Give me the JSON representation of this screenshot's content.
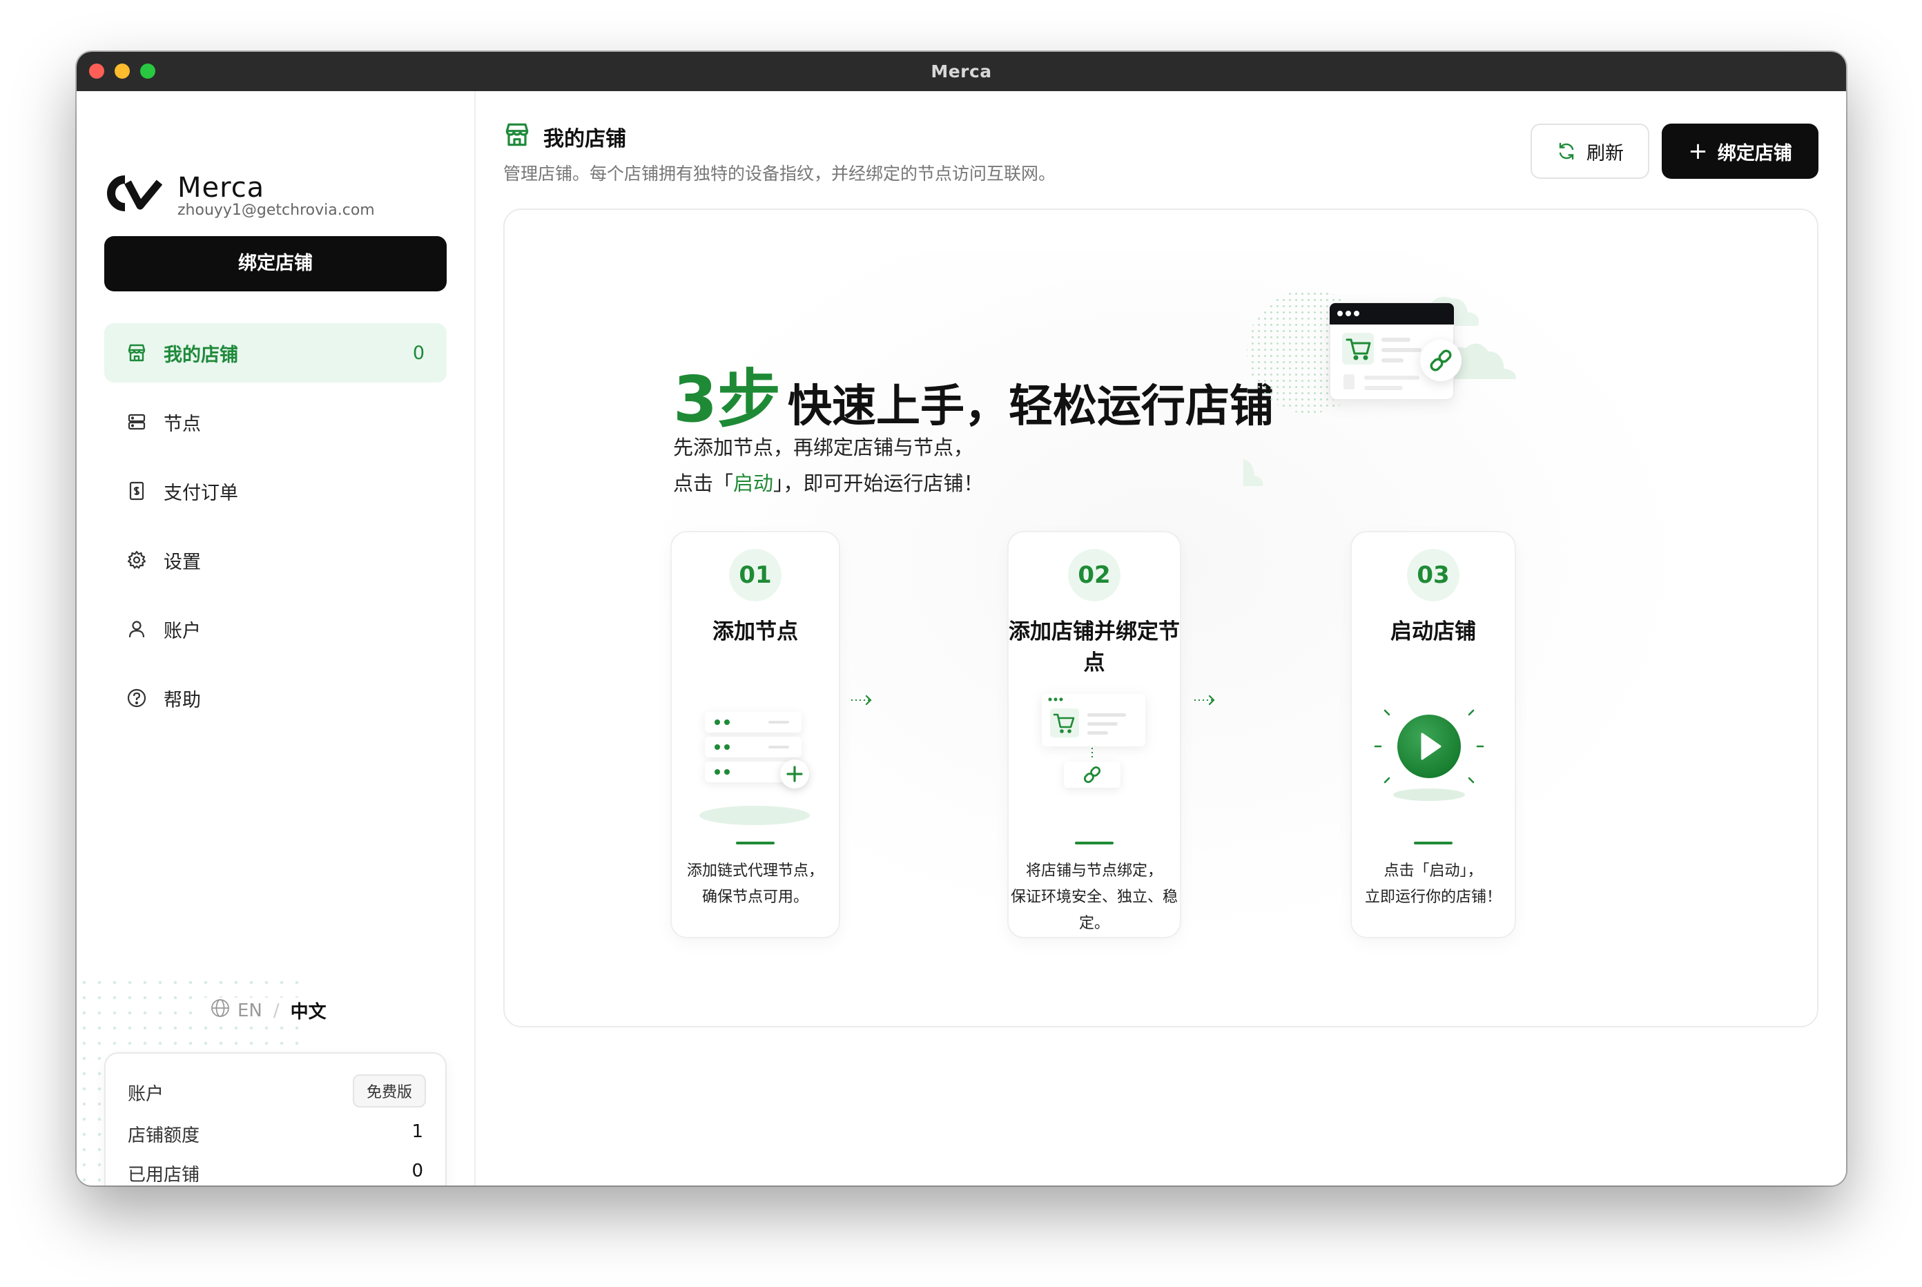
{
  "window": {
    "title": "Merca"
  },
  "sidebar": {
    "brand_name": "Merca",
    "email": "zhouyy1@getchrovia.com",
    "bind_button": "绑定店铺",
    "nav": [
      {
        "label": "我的店铺",
        "icon": "store-icon",
        "count": "0",
        "active": true
      },
      {
        "label": "节点",
        "icon": "server-icon"
      },
      {
        "label": "支付订单",
        "icon": "receipt-icon"
      },
      {
        "label": "设置",
        "icon": "gear-icon"
      },
      {
        "label": "账户",
        "icon": "user-icon"
      },
      {
        "label": "帮助",
        "icon": "help-icon"
      }
    ],
    "lang": {
      "en": "EN",
      "separator": "/",
      "zh": "中文"
    },
    "account": {
      "title": "账户",
      "plan": "免费版",
      "quota_label": "店铺额度",
      "quota_value": "1",
      "used_label": "已用店铺",
      "used_value": "0"
    }
  },
  "header": {
    "title": "我的店铺",
    "subtitle": "管理店铺。每个店铺拥有独特的设备指纹，并经绑定的节点访问互联网。",
    "refresh_label": "刷新",
    "bind_label": "绑定店铺"
  },
  "hero": {
    "number": "3步",
    "headline": "快速上手，轻松运行店铺",
    "line1": "先添加节点，再绑定店铺与节点，",
    "line2_prefix": "点击「",
    "line2_highlight": "启动",
    "line2_suffix": "」，即可开始运行店铺！"
  },
  "steps": [
    {
      "num": "01",
      "title": "添加节点",
      "desc1": "添加链式代理节点，",
      "desc2": "确保节点可用。"
    },
    {
      "num": "02",
      "title": "添加店铺并绑定节点",
      "desc1": "将店铺与节点绑定，",
      "desc2": "保证环境安全、独立、稳定。"
    },
    {
      "num": "03",
      "title": "启动店铺",
      "desc1": "点击「启动」，",
      "desc2": "立即运行你的店铺！"
    }
  ],
  "colors": {
    "accent": "#1f8a36",
    "active_bg": "#eaf7ef",
    "button_dark": "#0d0d0d"
  }
}
